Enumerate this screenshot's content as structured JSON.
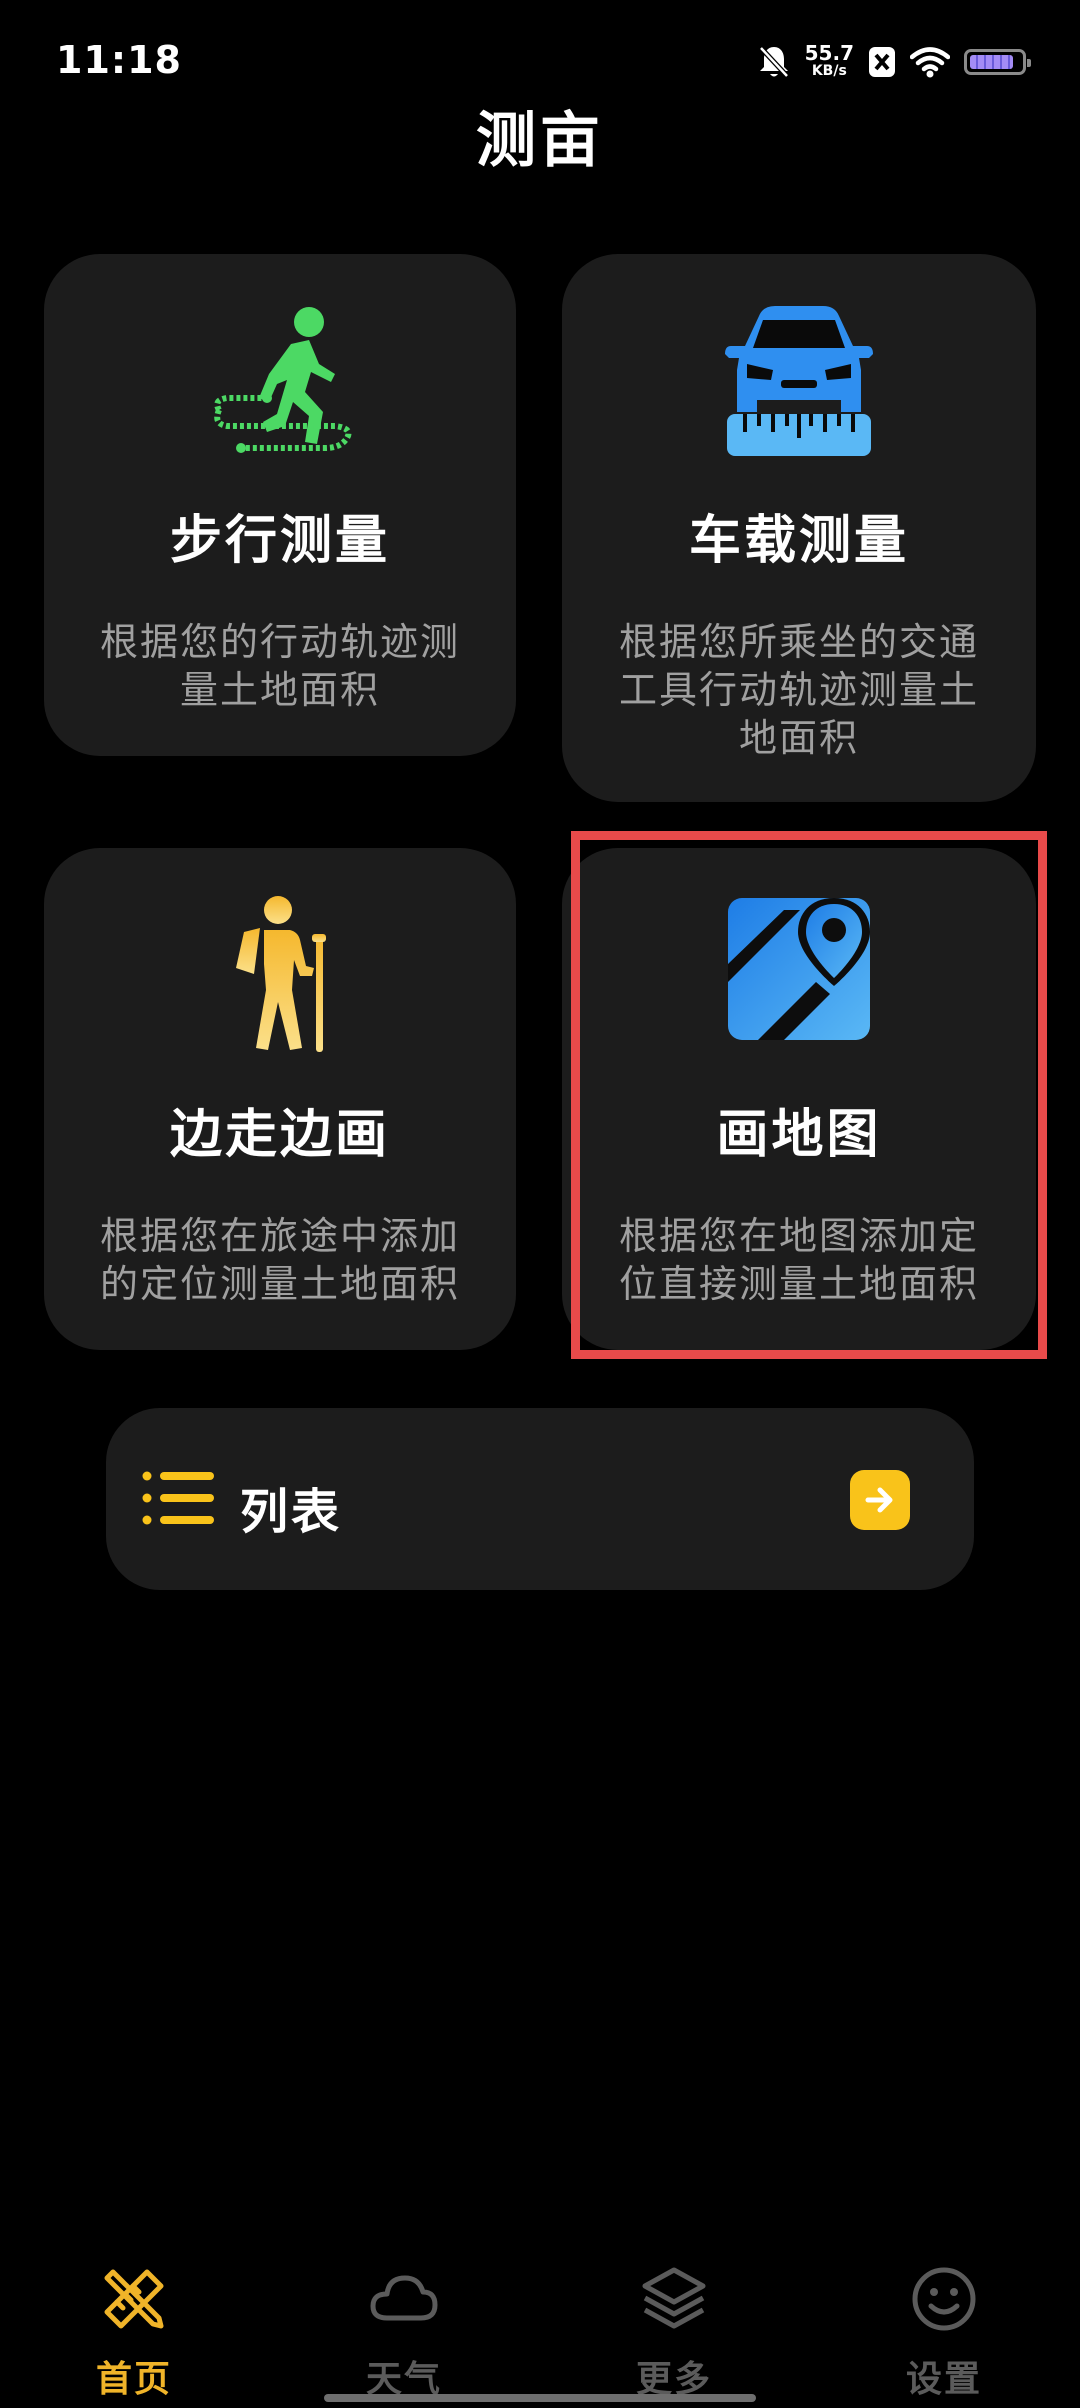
{
  "status_bar": {
    "time": "11:18",
    "net_speed_value": "55.7",
    "net_speed_unit": "KB/s",
    "icons": [
      "bell-off-icon",
      "app-badge-icon",
      "wifi-icon",
      "battery-icon"
    ],
    "battery_level": 0.85
  },
  "page": {
    "title": "测亩"
  },
  "cards": [
    {
      "id": "walk",
      "icon": "walking-person-icon",
      "title": "步行测量",
      "desc": "根据您的行动轨迹测量土地面积"
    },
    {
      "id": "car",
      "icon": "car-ruler-icon",
      "title": "车载测量",
      "desc": "根据您所乘坐的交通工具行动轨迹测量土地面积"
    },
    {
      "id": "hike",
      "icon": "hiker-icon",
      "title": "边走边画",
      "desc": "根据您在旅途中添加的定位测量土地面积"
    },
    {
      "id": "draw",
      "icon": "map-pin-icon",
      "title": "画地图",
      "desc": "根据您在地图添加定位直接测量土地面积"
    }
  ],
  "list_bar": {
    "icon": "list-icon",
    "label": "列表",
    "action_icon": "arrow-right-icon"
  },
  "bottom_nav": {
    "items": [
      {
        "label": "首页",
        "icon": "pencil-ruler-icon",
        "active": true
      },
      {
        "label": "天气",
        "icon": "cloud-icon",
        "active": false
      },
      {
        "label": "更多",
        "icon": "layers-icon",
        "active": false
      },
      {
        "label": "设置",
        "icon": "smiley-icon",
        "active": false
      }
    ]
  },
  "colors": {
    "background": "#000000",
    "card": "#1c1c1c",
    "accent_yellow": "#f9c31a",
    "active_tab": "#f0b429",
    "inactive_tab": "#5b5b5b",
    "walk_green": "#4cd964",
    "blue_icon": "#3aa0f0",
    "highlight_red": "#e84a4a"
  }
}
